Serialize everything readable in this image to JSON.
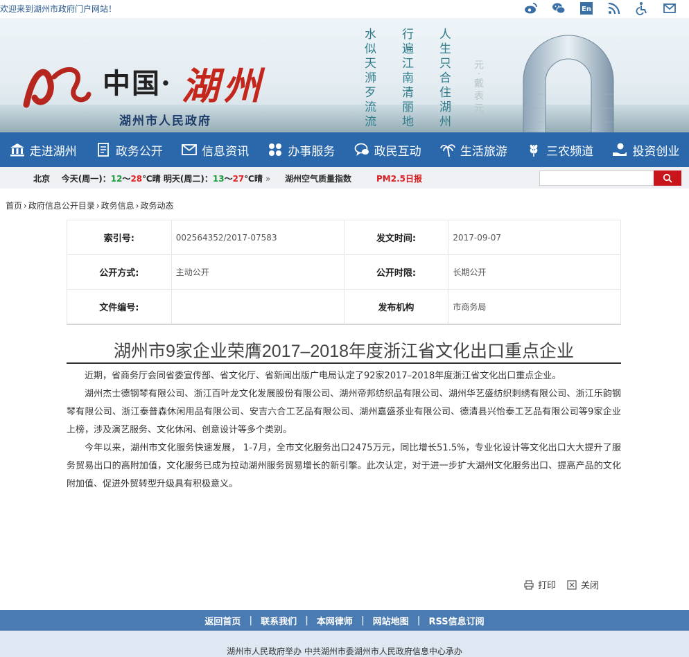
{
  "topbar": {
    "welcome": "欢迎来到湖州市政府门户网站！",
    "icons": [
      "weibo-icon",
      "wechat-icon",
      "english-icon",
      "rss-icon",
      "accessibility-icon",
      "mail-icon"
    ],
    "english_label": "En"
  },
  "banner": {
    "logo_main": "中国·",
    "logo_city": "湖州",
    "logo_sub": "湖州市人民政府",
    "poems": [
      "人生只合住湖州",
      "行遍江南清丽地",
      "水似天浉歹流流",
      "元·戴表元"
    ]
  },
  "nav": {
    "items": [
      {
        "label": "走进湖州",
        "icon": "bank-icon"
      },
      {
        "label": "政务公开",
        "icon": "document-icon"
      },
      {
        "label": "信息资讯",
        "icon": "envelope-icon"
      },
      {
        "label": "办事服务",
        "icon": "grid-icon"
      },
      {
        "label": "政民互动",
        "icon": "chat-icon"
      },
      {
        "label": "生活旅游",
        "icon": "palm-icon"
      },
      {
        "label": "三农频道",
        "icon": "wheat-icon"
      },
      {
        "label": "投资创业",
        "icon": "hand-coin-icon"
      }
    ]
  },
  "weather": {
    "city": "北京",
    "today_label": "今天(周一)：",
    "today_low": "12",
    "today_sep": "～",
    "today_high": "28",
    "today_desc": "℃晴",
    "tomorrow_label": "明天(周二)：",
    "tomorrow_low": "13",
    "tomorrow_sep": "～",
    "tomorrow_high": "27",
    "tomorrow_desc": "℃晴",
    "more": "»",
    "air_label": "湖州空气质量指数",
    "pm_label": "PM2.5日报"
  },
  "search": {
    "placeholder": ""
  },
  "breadcrumb": [
    "首页",
    "政府信息公开目录",
    "政务信息",
    "政务动态"
  ],
  "breadcrumb_sep": "›",
  "meta": {
    "index_label": "索引号:",
    "index_value": "002564352/2017-07583",
    "date_label": "发文时间:",
    "date_value": "2017-09-07",
    "method_label": "公开方式:",
    "method_value": "主动公开",
    "period_label": "公开时限:",
    "period_value": "长期公开",
    "doc_no_label": "文件编号:",
    "doc_no_value": "",
    "publisher_label": "发布机构",
    "publisher_value": "市商务局"
  },
  "article": {
    "title": "湖州市9家企业荣膺2017–2018年度浙江省文化出口重点企业",
    "paragraphs": [
      "近期，省商务厅会同省委宣传部、省文化厅、省新闻出版广电局认定了92家2017–2018年度浙江省文化出口重点企业。",
      "湖州杰士德钢琴有限公司、浙江百叶龙文化发展股份有限公司、湖州帝邦纺织品有限公司、湖州华艺盛纺织刺绣有限公司、浙江乐韵钢琴有限公司、浙江泰普森休闲用品有限公司、安吉六合工艺品有限公司、湖州嘉盛茶业有限公司、德清县兴怡泰工艺品有限公司等9家企业上榜，涉及演艺服务、文化休闲、创意设计等多个类别。",
      "今年以来，湖州市文化服务快速发展， 1-7月，全市文化服务出口2475万元，同比增长51.5%，专业化设计等文化出口大大提升了服务贸易出口的高附加值，文化服务已成为拉动湖州服务贸易增长的新引擎。此次认定，对于进一步扩大湖州文化服务出口、提高产品的文化附加值、促进外贸转型升级具有积极意义。"
    ]
  },
  "actions": {
    "print": "打印",
    "close": "关闭"
  },
  "footer": {
    "links": [
      "返回首页",
      "联系我们",
      "本网律师",
      "网站地图",
      "RSS信息订阅"
    ],
    "sep": "|",
    "info": "湖州市人民政府举办 中共湖州市委湖州市人民政府信息中心承办"
  },
  "colors": {
    "nav_bg": "#2a68ab",
    "accent_red": "#c8151b",
    "footer_bg": "#4a7bb3"
  }
}
